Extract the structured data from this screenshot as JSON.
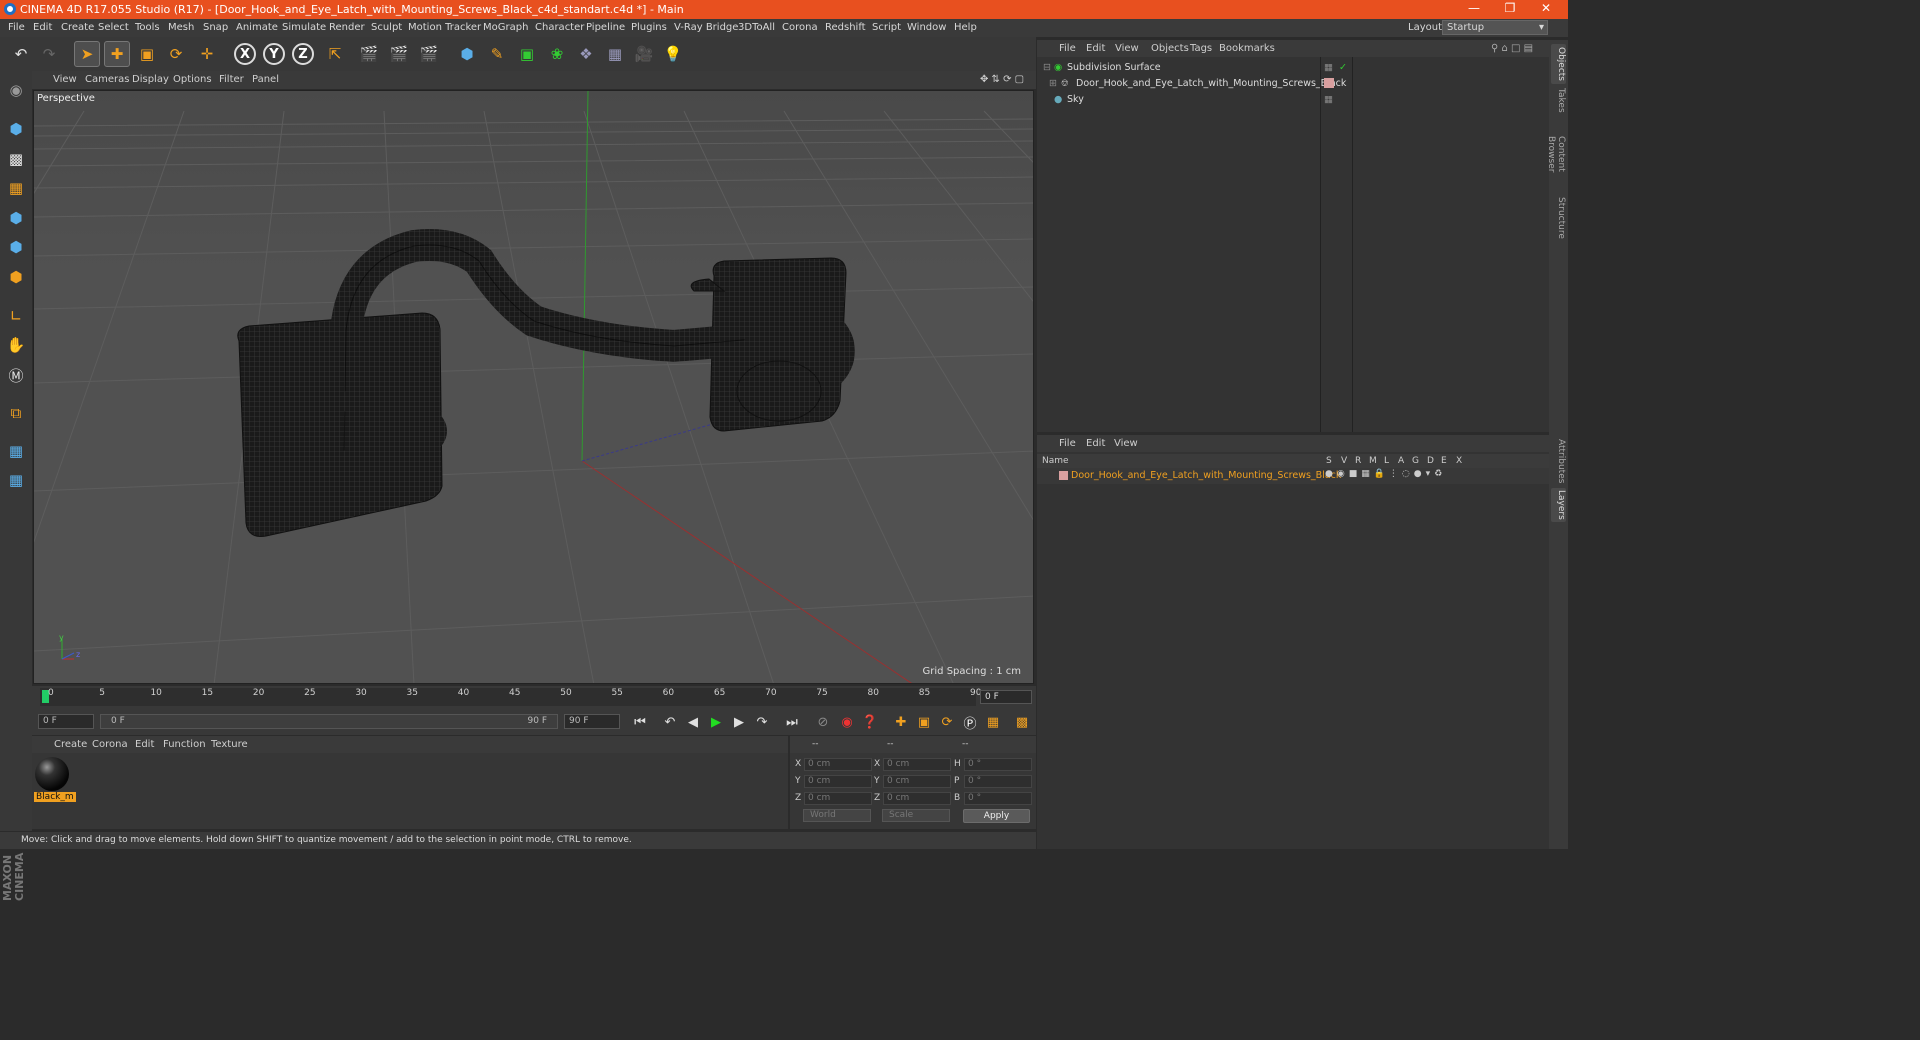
{
  "window": {
    "title": "CINEMA 4D R17.055 Studio (R17) - [Door_Hook_and_Eye_Latch_with_Mounting_Screws_Black_c4d_standart.c4d *] - Main"
  },
  "menu": [
    "File",
    "Edit",
    "Create",
    "Select",
    "Tools",
    "Mesh",
    "Snap",
    "Animate",
    "Simulate",
    "Render",
    "Sculpt",
    "Motion Tracker",
    "MoGraph",
    "Character",
    "Pipeline",
    "Plugins",
    "V-Ray Bridge",
    "3DToAll",
    "Corona",
    "Redshift",
    "Script",
    "Window",
    "Help"
  ],
  "layout": {
    "label": "Layout:",
    "value": "Startup"
  },
  "viewport": {
    "menu": [
      "View",
      "Cameras",
      "Display",
      "Options",
      "Filter",
      "Panel"
    ],
    "label": "Perspective",
    "grid_spacing": "Grid Spacing : 1 cm"
  },
  "timeline": {
    "ticks": [
      "0",
      "5",
      "10",
      "15",
      "20",
      "25",
      "30",
      "35",
      "40",
      "45",
      "50",
      "55",
      "60",
      "65",
      "70",
      "75",
      "80",
      "85",
      "90"
    ],
    "current_frame": "0 F"
  },
  "transport": {
    "start": "0 F",
    "range_start": "0 F",
    "range_end": "90 F",
    "end": "90 F"
  },
  "material_manager": {
    "menu": [
      "Create",
      "Corona",
      "Edit",
      "Function",
      "Texture"
    ],
    "materials": [
      {
        "name": "Black_m"
      }
    ]
  },
  "coordinates": {
    "header": [
      "--",
      "--",
      "--"
    ],
    "rows": [
      {
        "l1": "X",
        "v1": "0 cm",
        "l2": "X",
        "v2": "0 cm",
        "l3": "H",
        "v3": "0 °"
      },
      {
        "l1": "Y",
        "v1": "0 cm",
        "l2": "Y",
        "v2": "0 cm",
        "l3": "P",
        "v3": "0 °"
      },
      {
        "l1": "Z",
        "v1": "0 cm",
        "l2": "Z",
        "v2": "0 cm",
        "l3": "B",
        "v3": "0 °"
      }
    ],
    "mode1": "World",
    "mode2": "Scale",
    "apply": "Apply"
  },
  "status": "Move: Click and drag to move elements. Hold down SHIFT to quantize movement / add to the selection in point mode, CTRL to remove.",
  "object_manager": {
    "menu": [
      "File",
      "Edit",
      "View",
      "Objects",
      "Tags",
      "Bookmarks"
    ],
    "objects": [
      {
        "name": "Subdivision Surface"
      },
      {
        "name": "Door_Hook_and_Eye_Latch_with_Mounting_Screws_Black"
      },
      {
        "name": "Sky"
      }
    ]
  },
  "layer_manager": {
    "menu": [
      "File",
      "Edit",
      "View"
    ],
    "columns": [
      "Name",
      "S",
      "V",
      "R",
      "M",
      "L",
      "A",
      "G",
      "D",
      "E",
      "X"
    ],
    "layers": [
      {
        "name": "Door_Hook_and_Eye_Latch_with_Mounting_Screws_Black",
        "color": "#d9a0a0"
      }
    ]
  },
  "right_tabs": [
    "Objects",
    "Takes",
    "Content Browser",
    "Structure",
    "Attributes",
    "Layers"
  ],
  "logo": {
    "line1": "MAXON",
    "line2": "CINEMA 4D"
  },
  "colors": {
    "title_bar": "#e8501f",
    "accent_orange": "#f0a020",
    "playhead_green": "#22cc66"
  }
}
